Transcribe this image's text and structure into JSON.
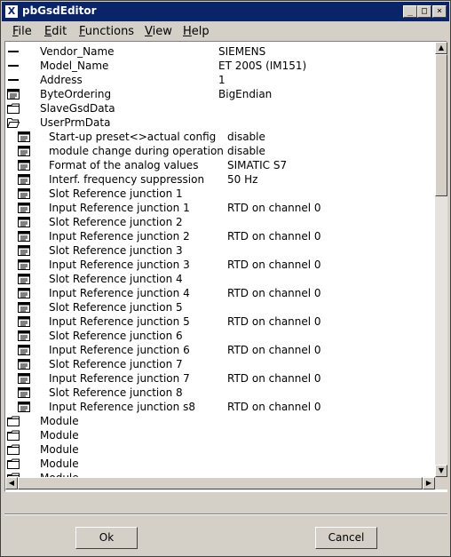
{
  "window": {
    "title": "pbGsdEditor"
  },
  "menu": [
    {
      "label": "File",
      "u": "F",
      "rest": "ile"
    },
    {
      "label": "Edit",
      "u": "E",
      "rest": "dit"
    },
    {
      "label": "Functions",
      "u": "F",
      "rest": "unctions"
    },
    {
      "label": "View",
      "u": "V",
      "rest": "iew"
    },
    {
      "label": "Help",
      "u": "H",
      "rest": "elp"
    }
  ],
  "tree": [
    {
      "icon": "dash",
      "name": "Vendor_Name",
      "value": "SIEMENS",
      "level": 0
    },
    {
      "icon": "dash",
      "name": "Model_Name",
      "value": "ET 200S (IM151)",
      "level": 0
    },
    {
      "icon": "dash",
      "name": "Address",
      "value": "1",
      "level": 0
    },
    {
      "icon": "list",
      "name": "ByteOrdering",
      "value": "BigEndian",
      "level": 0
    },
    {
      "icon": "folder",
      "name": "SlaveGsdData",
      "value": "",
      "level": 0
    },
    {
      "icon": "folder-open",
      "name": "UserPrmData",
      "value": "",
      "level": 0
    },
    {
      "icon": "list",
      "name": "Start-up preset<>actual config",
      "value": "disable",
      "level": 1
    },
    {
      "icon": "list",
      "name": "module change during operation",
      "value": "disable",
      "level": 1
    },
    {
      "icon": "list",
      "name": "Format of the analog values",
      "value": "SIMATIC S7",
      "level": 1
    },
    {
      "icon": "list",
      "name": "Interf. frequency suppression",
      "value": "50 Hz",
      "level": 1
    },
    {
      "icon": "list",
      "name": "Slot Reference junction 1",
      "value": "",
      "level": 1
    },
    {
      "icon": "list",
      "name": "Input Reference junction 1",
      "value": "RTD on channel 0",
      "level": 1
    },
    {
      "icon": "list",
      "name": "Slot Reference junction 2",
      "value": "",
      "level": 1
    },
    {
      "icon": "list",
      "name": "Input Reference junction 2",
      "value": "RTD on channel 0",
      "level": 1
    },
    {
      "icon": "list",
      "name": "Slot Reference junction 3",
      "value": "",
      "level": 1
    },
    {
      "icon": "list",
      "name": "Input Reference junction 3",
      "value": "RTD on channel 0",
      "level": 1
    },
    {
      "icon": "list",
      "name": "Slot Reference junction 4",
      "value": "",
      "level": 1
    },
    {
      "icon": "list",
      "name": "Input Reference junction 4",
      "value": "RTD on channel 0",
      "level": 1
    },
    {
      "icon": "list",
      "name": "Slot Reference junction 5",
      "value": "",
      "level": 1
    },
    {
      "icon": "list",
      "name": "Input Reference junction 5",
      "value": "RTD on channel 0",
      "level": 1
    },
    {
      "icon": "list",
      "name": "Slot Reference junction 6",
      "value": "",
      "level": 1
    },
    {
      "icon": "list",
      "name": "Input Reference junction 6",
      "value": "RTD on channel 0",
      "level": 1
    },
    {
      "icon": "list",
      "name": "Slot Reference junction 7",
      "value": "",
      "level": 1
    },
    {
      "icon": "list",
      "name": "Input Reference junction 7",
      "value": "RTD on channel 0",
      "level": 1
    },
    {
      "icon": "list",
      "name": "Slot Reference junction 8",
      "value": "",
      "level": 1
    },
    {
      "icon": "list",
      "name": "Input Reference junction s8",
      "value": "RTD on channel 0",
      "level": 1
    },
    {
      "icon": "folder",
      "name": "Module",
      "value": "",
      "level": 0
    },
    {
      "icon": "folder",
      "name": "Module",
      "value": "",
      "level": 0
    },
    {
      "icon": "folder",
      "name": "Module",
      "value": "",
      "level": 0
    },
    {
      "icon": "folder",
      "name": "Module",
      "value": "",
      "level": 0
    },
    {
      "icon": "folder",
      "name": "Module",
      "value": "",
      "level": 0
    }
  ],
  "buttons": {
    "ok": "Ok",
    "cancel": "Cancel"
  }
}
